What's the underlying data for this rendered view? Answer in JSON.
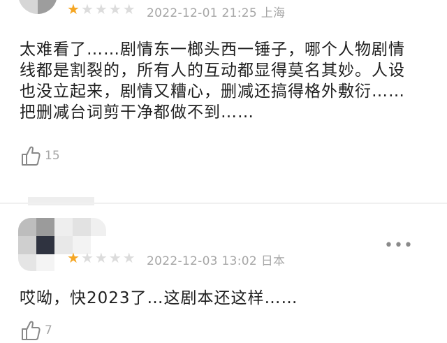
{
  "comments": [
    {
      "rating": 1,
      "max_rating": 5,
      "date": "2022-12-01 21:25",
      "location": "上海",
      "text": "太难看了……剧情东一榔头西一锤子，哪个人物剧情线都是割裂的，所有人的互动都显得莫名其妙。人设也没立起来，剧情又糟心，删减还搞得格外敷衍……把删减台词剪干净都做不到……",
      "likes": "15"
    },
    {
      "rating": 1,
      "max_rating": 5,
      "date": "2022-12-03 13:02",
      "location": "日本",
      "text": "哎呦，快2023了…这剧本还这样……",
      "likes": "7",
      "more_label": "•••"
    }
  ],
  "icons": {
    "star": "star-icon",
    "like": "thumbs-up-icon",
    "more": "more-icon"
  },
  "colors": {
    "star_active": "#f5a623",
    "star_inactive": "#dcdcdc",
    "meta_text": "#a6a6a6"
  }
}
